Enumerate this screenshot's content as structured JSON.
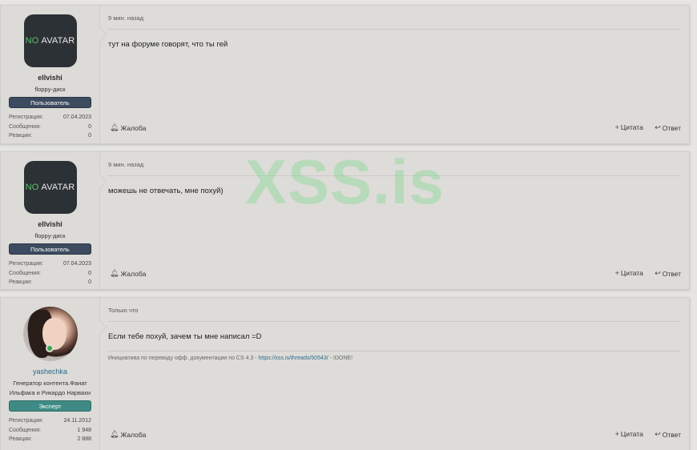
{
  "posts": [
    {
      "time": "9 мин. назад",
      "message": "тут на форуме говорят, что ты гей",
      "user": {
        "avatar_no": "NO",
        "avatar_text": "AVATAR",
        "name": "ellvishi",
        "title": "floppy-диск",
        "badge": "Пользователь",
        "reg_label": "Регистрация:",
        "reg_value": "07.04.2023",
        "msgs_label": "Сообщения:",
        "msgs_value": "0",
        "react_label": "Реакции:",
        "react_value": "0"
      },
      "actions": {
        "report": "Жалоба",
        "quote": "Цитата",
        "reply": "Ответ"
      }
    },
    {
      "time": "9 мин. назад",
      "message": "можешь не отвечать, мне похуй)",
      "user": {
        "avatar_no": "NO",
        "avatar_text": "AVATAR",
        "name": "ellvishi",
        "title": "floppy-диск",
        "badge": "Пользователь",
        "reg_label": "Регистрация:",
        "reg_value": "07.04.2023",
        "msgs_label": "Сообщения:",
        "msgs_value": "0",
        "react_label": "Реакции:",
        "react_value": "0"
      },
      "actions": {
        "report": "Жалоба",
        "quote": "Цитата",
        "reply": "Ответ"
      }
    },
    {
      "time": "Только что",
      "message": "Если тебе похуй, зачем ты мне написал =D",
      "signature_prefix": "Инициатива по переводу офф. документации по CS 4.3 - ",
      "signature_link": "https://xss.is/threads/50543/",
      "signature_suffix": " - !DONE!",
      "user": {
        "name": "yashechka",
        "title": "Генератор контента.Фанат Ильфака и Рикардо Нарвахи",
        "badge": "Эксперт",
        "reg_label": "Регистрация:",
        "reg_value": "24.11.2012",
        "msgs_label": "Сообщения:",
        "msgs_value": "1 948",
        "react_label": "Реакции:",
        "react_value": "2 888"
      },
      "actions": {
        "report": "Жалоба",
        "quote": "Цитата",
        "reply": "Ответ"
      }
    }
  ],
  "watermark": "XSS.is",
  "colors": {
    "page_bg": "#e6e5e1",
    "badge_user": "#3d4b60",
    "badge_expert": "#3f8a84",
    "link": "#2e6b8a",
    "watermark": "#78d78c"
  },
  "icons": {
    "report": "bell-icon",
    "quote": "plus-icon",
    "reply": "reply-arrow-icon"
  }
}
